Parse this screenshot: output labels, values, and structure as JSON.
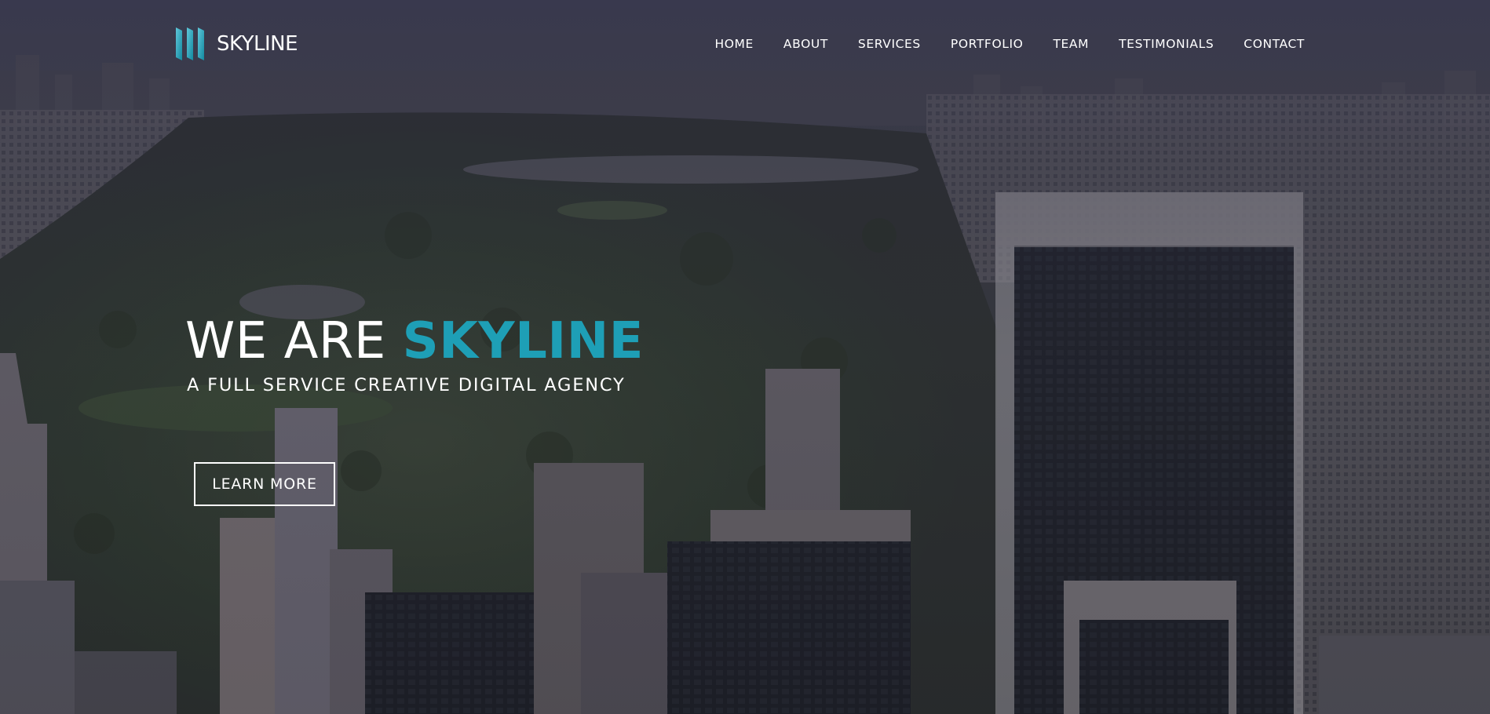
{
  "brand": {
    "name": "SKYLINE",
    "logo_icon": "skyline-bars-icon",
    "accent_color": "#1e9fb6"
  },
  "nav": {
    "items": [
      {
        "label": "HOME"
      },
      {
        "label": "ABOUT"
      },
      {
        "label": "SERVICES"
      },
      {
        "label": "PORTFOLIO"
      },
      {
        "label": "TEAM"
      },
      {
        "label": "TESTIMONIALS"
      },
      {
        "label": "CONTACT"
      }
    ]
  },
  "hero": {
    "title_prefix": "WE ARE ",
    "title_accent": "SKYLINE",
    "subtitle": "A FULL SERVICE CREATIVE DIGITAL AGENCY",
    "cta_label": "LEARN MORE",
    "background": "aerial city skyline with park, dark overlay"
  },
  "colors": {
    "overlay": "#2b2d3a",
    "text": "#ffffff",
    "accent": "#1e9fb6"
  }
}
